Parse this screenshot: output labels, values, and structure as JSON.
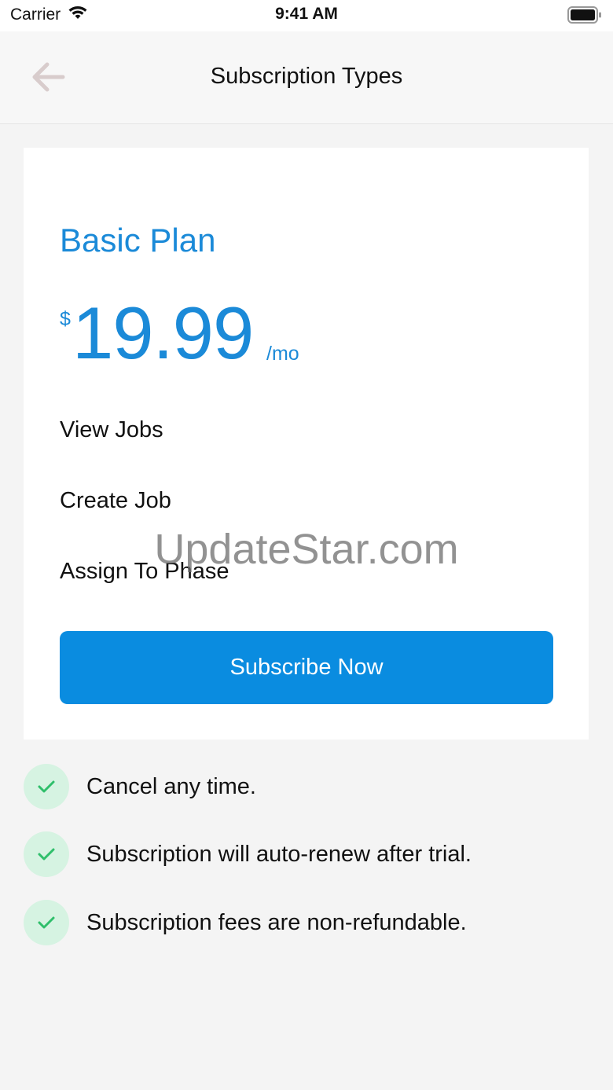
{
  "status_bar": {
    "carrier": "Carrier",
    "time": "9:41 AM"
  },
  "navbar": {
    "title": "Subscription Types"
  },
  "plan": {
    "name": "Basic Plan",
    "currency": "$",
    "amount": "19.99",
    "period": "/mo",
    "features": [
      "View Jobs",
      "Create Job",
      "Assign To Phase"
    ],
    "button_label": "Subscribe Now"
  },
  "notes": [
    "Cancel any time.",
    "Subscription will auto-renew after trial.",
    "Subscription fees are non-refundable."
  ],
  "watermark": "UpdateStar.com",
  "colors": {
    "accent": "#0a8ce0",
    "plan_text": "#1b8ad8",
    "check_bg": "#d6f3e2",
    "check_mark": "#2fbf6b"
  },
  "icons": {
    "back": "arrow-left-icon",
    "wifi": "wifi-icon",
    "battery": "battery-icon",
    "check": "check-icon"
  }
}
